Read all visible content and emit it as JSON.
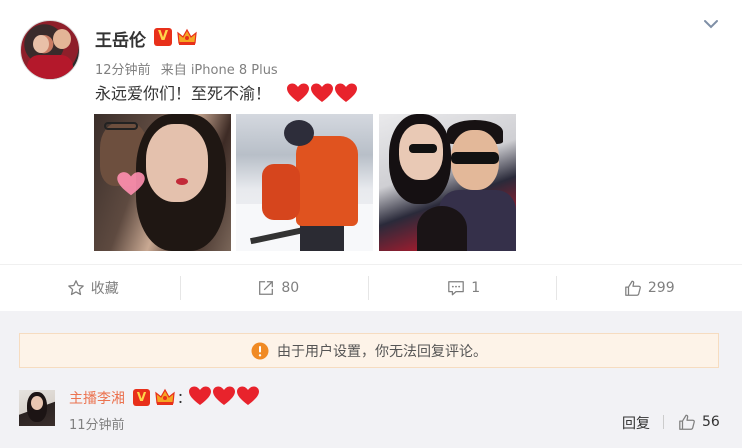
{
  "post": {
    "author": "王岳伦",
    "time": "12分钟前",
    "source": "来自 iPhone 8 Plus",
    "text": "永远爱你们！至死不渝！",
    "verified_badge": "V",
    "emoji_hearts": 3,
    "photo_count": 3
  },
  "actions": {
    "favorite_label": "收藏",
    "repost_count": "80",
    "comment_count": "1",
    "like_count": "299"
  },
  "comments_section": {
    "notice": "由于用户设置，你无法回复评论。",
    "comment": {
      "author": "主播李湘",
      "verified_badge": "V",
      "colon": "：",
      "emoji_hearts": 3,
      "time": "11分钟前",
      "reply_label": "回复",
      "like_count": "56"
    }
  },
  "colors": {
    "accent_orange": "#eb7350",
    "heart_red": "#e8232c",
    "badge_red": "#e8301a",
    "notice_bg": "#fdf3e8",
    "text_muted": "#808080"
  }
}
